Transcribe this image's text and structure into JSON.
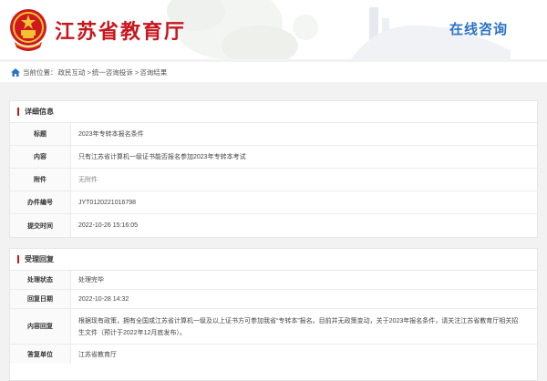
{
  "header": {
    "site_title": "江苏省教育厅",
    "consult_title": "在线咨询"
  },
  "breadcrumb": {
    "prefix": "当前位置：",
    "items": [
      "政民互动",
      "统一咨询投诉",
      "咨询结果"
    ],
    "separator": ">"
  },
  "detail": {
    "section_title": "详细信息",
    "rows": [
      {
        "label": "标题",
        "value": "2023年专转本报名条件"
      },
      {
        "label": "内容",
        "value": "只有江苏省计算机一级证书能否报名参加2023年专转本考试"
      },
      {
        "label": "附件",
        "value": "无附件"
      },
      {
        "label": "办件编号",
        "value": "JYT0120221016798"
      },
      {
        "label": "提交时间",
        "value": "2022-10-26 15:16:05"
      }
    ]
  },
  "reply": {
    "section_title": "受理回复",
    "rows": [
      {
        "label": "处理状态",
        "value": "处理完毕"
      },
      {
        "label": "回复日期",
        "value": "2022-10-28 14:32"
      },
      {
        "label": "内容回复",
        "value": "根据现有政策，拥有全国或江苏省计算机一级及以上证书方可参加我省“专转本”报名。目前并无政策变动，关于2023年报名条件，请关注江苏省教育厅相关招生文件（预计于2022年12月底发布）。"
      },
      {
        "label": "答复单位",
        "value": "江苏省教育厅"
      }
    ]
  },
  "colors": {
    "brand_red": "#c8161d",
    "accent_blue": "#2b73c6"
  }
}
